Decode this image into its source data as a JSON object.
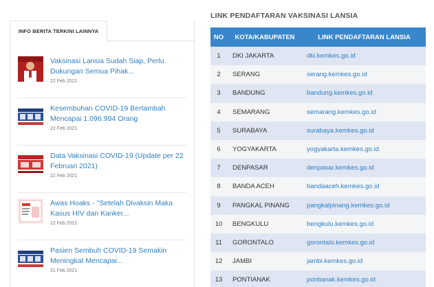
{
  "left": {
    "tab_label": "INFO BERITA TERKINI LAINNYA",
    "news": [
      {
        "title": "Vaksinasi Lansia Sudah Siap, Perlu Dukungan Semua Pihak...",
        "date": "22 Feb 2021",
        "thumb": "person-photo"
      },
      {
        "title": "Kesembuhan COVID-19 Bertambah Mencapai 1.096.994 Orang",
        "date": "22 Feb 2021",
        "thumb": "infographic-blue"
      },
      {
        "title": "Data Vaksinasi COVID-19 (Update per 22 Februari 2021)",
        "date": "22 Feb 2021",
        "thumb": "infographic-red"
      },
      {
        "title": "Awas Hoaks - \"Setelah Divaksin Maka Kasus HIV dan Kanker...",
        "date": "22 Feb 2021",
        "thumb": "hoax-card"
      },
      {
        "title": "Pasien Sembuh COVID-19 Semakin Meningkat Mencapai...",
        "date": "21 Feb 2021",
        "thumb": "infographic-blue"
      }
    ]
  },
  "right": {
    "heading": "LINK PENDAFTARAN VAKSINASI LANSIA",
    "headers": {
      "no": "NO",
      "city": "KOTA/KABUPATEN",
      "link": "LINK PENDAFTARAN LANSIA"
    },
    "rows": [
      {
        "no": "1",
        "city": "DKI JAKARTA",
        "link": "dki.kemkes.go.id"
      },
      {
        "no": "2",
        "city": "SERANG",
        "link": "serang.kemkes.go.id"
      },
      {
        "no": "3",
        "city": "BANDUNG",
        "link": "bandung.kemkes.go.id"
      },
      {
        "no": "4",
        "city": "SEMARANG",
        "link": "semarang.kemkes.go.id"
      },
      {
        "no": "5",
        "city": "SURABAYA",
        "link": "surabaya.kemkes.go.id"
      },
      {
        "no": "6",
        "city": "YOGYAKARTA",
        "link": "yogyakarta.kemkes.go.id"
      },
      {
        "no": "7",
        "city": "DENPASAR",
        "link": "denpasar.kemkes.go.id"
      },
      {
        "no": "8",
        "city": "BANDA ACEH",
        "link": "bandaaceh.kemkes.go.id"
      },
      {
        "no": "9",
        "city": "PANGKAL PINANG",
        "link": "pangkalpinang.kemkes.go.id"
      },
      {
        "no": "10",
        "city": "BENGKULU",
        "link": "bengkulu.kemkes.go.id"
      },
      {
        "no": "11",
        "city": "GORONTALO",
        "link": "gorontalo.kemkes.go.id"
      },
      {
        "no": "12",
        "city": "JAMBI",
        "link": "jambi.kemkes.go.id"
      },
      {
        "no": "13",
        "city": "PONTIANAK",
        "link": "pontianak.kemkes.go.id"
      }
    ]
  },
  "colors": {
    "accent": "#3a86cb",
    "link": "#2f7fc1",
    "row_odd": "#dfe5f2",
    "row_even": "#f4f5f7"
  }
}
